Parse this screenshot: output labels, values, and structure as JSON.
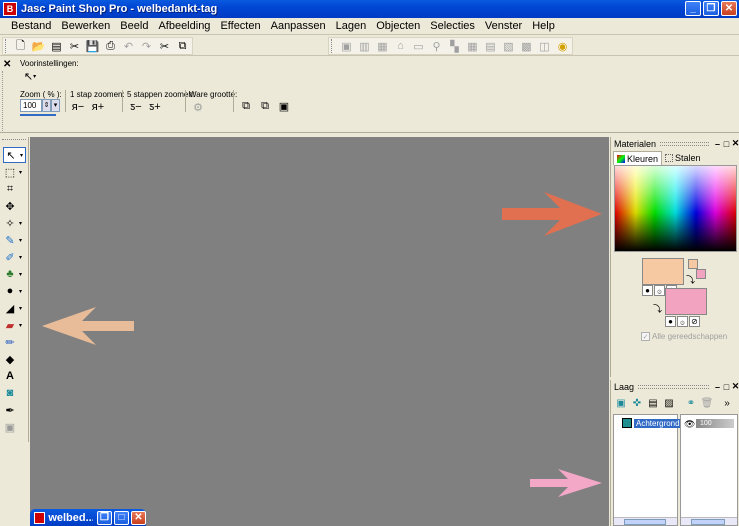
{
  "window": {
    "title": "Jasc Paint Shop Pro - welbedankt-tag",
    "app_icon_text": "B"
  },
  "menu": [
    "Bestand",
    "Bewerken",
    "Beeld",
    "Afbeelding",
    "Effecten",
    "Aanpassen",
    "Lagen",
    "Objecten",
    "Selecties",
    "Venster",
    "Help"
  ],
  "tool_options": {
    "presets_label": "Voorinstellingen:",
    "zoom_label": "Zoom ( % ):",
    "zoom_value": "100",
    "one_step_label": "1 stap zoomen:",
    "five_steps_label": "5 stappen zoomen:",
    "actual_size_label": "Ware grootte:"
  },
  "document": {
    "minimized_title": "welbed..."
  },
  "materials": {
    "title": "Materialen",
    "tab_colors": "Kleuren",
    "tab_swatches": "Stalen",
    "foreground_color": "#f6c9a3",
    "background_color": "#f2a3c0",
    "all_properties_label": "Alle gereedschappen"
  },
  "layers": {
    "title": "Laag",
    "layer_name": "Achtergrond",
    "opacity_text": "100"
  },
  "arrows": {
    "orange_color": "#e07050",
    "tan_color": "#e8bc98",
    "pink_color": "#f4a8c8"
  }
}
